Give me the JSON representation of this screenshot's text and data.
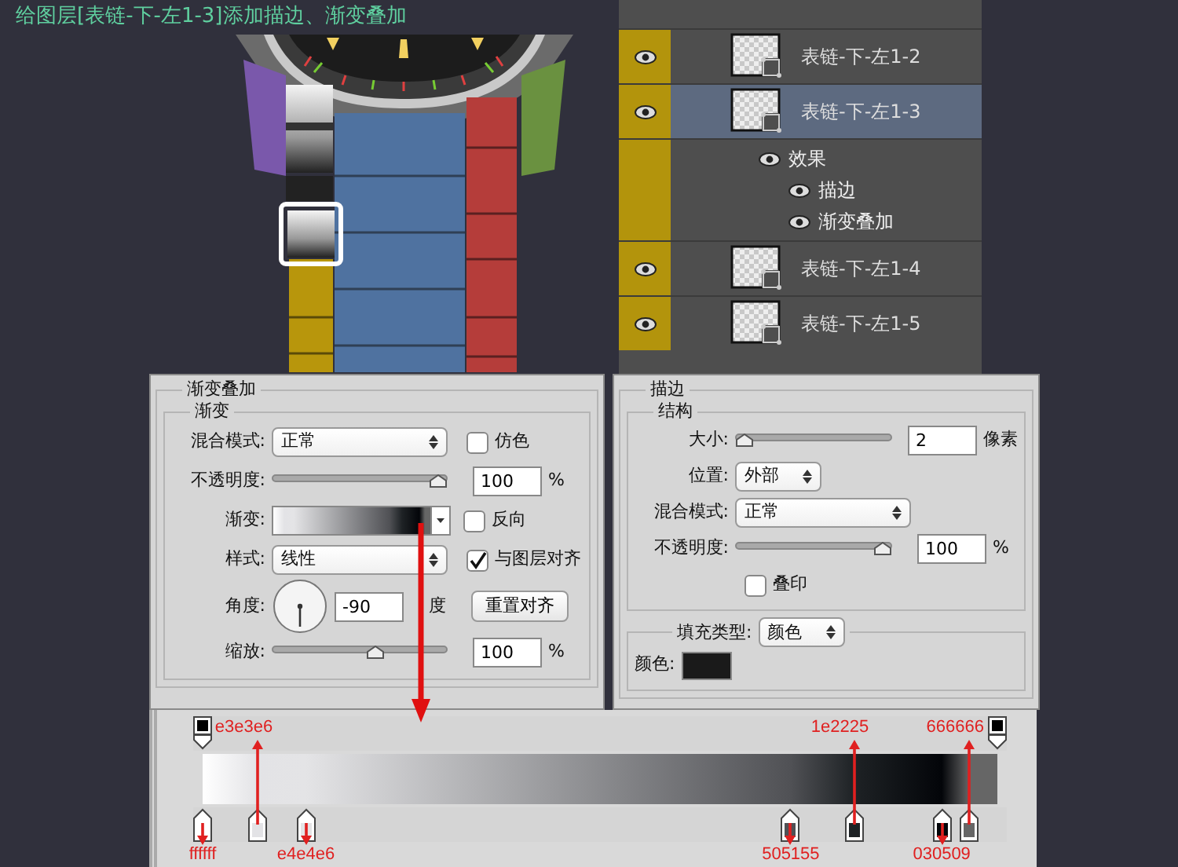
{
  "title": "给图层[表链-下-左1-3]添加描边、渐变叠加",
  "layers": [
    {
      "name": "表链-下-左1-2",
      "visible": true,
      "selected": false
    },
    {
      "name": "表链-下-左1-3",
      "visible": true,
      "selected": true,
      "effects": {
        "label": "效果",
        "visible": true,
        "items": [
          {
            "name": "描边",
            "visible": true
          },
          {
            "name": "渐变叠加",
            "visible": true
          }
        ]
      }
    },
    {
      "name": "表链-下-左1-4",
      "visible": true,
      "selected": false
    },
    {
      "name": "表链-下-左1-5",
      "visible": true,
      "selected": false
    }
  ],
  "gradient_overlay": {
    "title": "渐变叠加",
    "group": "渐变",
    "blend_mode": {
      "label": "混合模式:",
      "value": "正常"
    },
    "dither": {
      "label": "仿色",
      "checked": false
    },
    "opacity": {
      "label": "不透明度:",
      "level": 1,
      "value": "100",
      "unit": "%"
    },
    "gradient": {
      "label": "渐变:"
    },
    "reverse": {
      "label": "反向",
      "checked": false
    },
    "style": {
      "label": "样式:",
      "value": "线性"
    },
    "align": {
      "label": "与图层对齐",
      "checked": true
    },
    "angle": {
      "label": "角度:",
      "value": "-90",
      "unit": "度"
    },
    "reset_button": "重置对齐",
    "scale": {
      "label": "缩放:",
      "level": 0.6,
      "value": "100",
      "unit": "%"
    }
  },
  "stroke": {
    "title": "描边",
    "group": "结构",
    "size": {
      "label": "大小:",
      "level": 0,
      "value": "2",
      "unit": "像素"
    },
    "position": {
      "label": "位置:",
      "value": "外部"
    },
    "blend_mode": {
      "label": "混合模式:",
      "value": "正常"
    },
    "opacity": {
      "label": "不透明度:",
      "level": 1,
      "value": "100",
      "unit": "%"
    },
    "overprint": {
      "label": "叠印",
      "checked": false
    },
    "fill_type": {
      "label": "填充类型:",
      "value": "颜色"
    },
    "color": {
      "label": "颜色:",
      "color": "#1a1a1a"
    }
  },
  "gradient_editor": {
    "opacity_stops": [
      {
        "level": 0
      },
      {
        "level": 1
      }
    ],
    "color_stops": [
      {
        "level": 0,
        "color": "#ffffff",
        "label": "ffffff",
        "kind": "below"
      },
      {
        "level": 0.07,
        "color": "#e3e3e6",
        "label": "e3e3e6",
        "kind": "above"
      },
      {
        "level": 0.13,
        "color": "#e4e4e6",
        "label": "e4e4e6",
        "kind": "below"
      },
      {
        "level": 0.74,
        "color": "#505155",
        "label": "505155",
        "kind": "below"
      },
      {
        "level": 0.82,
        "color": "#1e2225",
        "label": "1e2225",
        "kind": "above"
      },
      {
        "level": 0.93,
        "color": "#030509",
        "label": "030509",
        "kind": "below"
      },
      {
        "level": 0.965,
        "color": "#666666",
        "label": "666666",
        "kind": "above"
      }
    ]
  }
}
